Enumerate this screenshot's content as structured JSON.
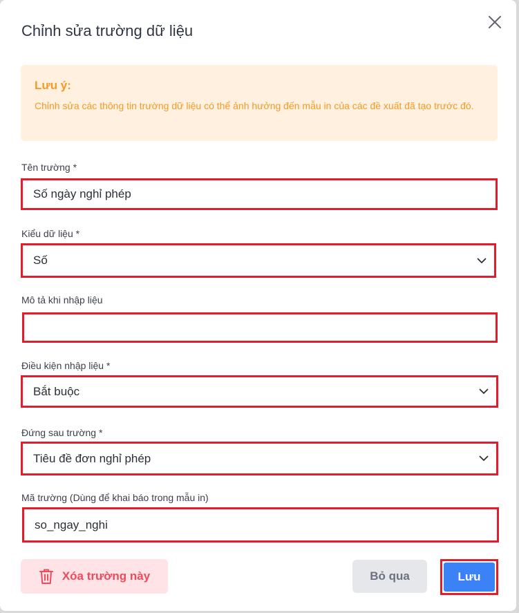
{
  "dialog": {
    "title": "Chỉnh sửa trường dữ liệu",
    "close_icon": "close-icon"
  },
  "notice": {
    "title": "Lưu ý:",
    "text": "Chỉnh sửa các thông tin trường dữ liệu có thể ảnh hưởng đến mẫu in của các đề xuất đã tạo trước đó.",
    "color": "#f59a23",
    "background": "#fff0e0"
  },
  "fields": {
    "field_name": {
      "label": "Tên trường *",
      "value": "Số ngày nghỉ phép"
    },
    "data_type": {
      "label": "Kiểu dữ liệu *",
      "value": "Số"
    },
    "description": {
      "label": "Mô tả khi nhập liệu",
      "value": ""
    },
    "input_condition": {
      "label": "Điều kiện nhập liệu *",
      "value": "Bắt buộc"
    },
    "after_field": {
      "label": "Đứng sau trường *",
      "value": "Tiêu đề đơn nghỉ phép"
    },
    "field_code": {
      "label": "Mã trường (Dùng để khai báo trong mẫu in)",
      "value": "so_ngay_nghi"
    }
  },
  "actions": {
    "delete_label": "Xóa trường này",
    "delete_icon": "trash-icon",
    "skip_label": "Bỏ qua",
    "save_label": "Lưu"
  },
  "colors": {
    "highlight": "#e21c2a",
    "primary": "#3b82f6",
    "danger": "#ee4a5a"
  }
}
